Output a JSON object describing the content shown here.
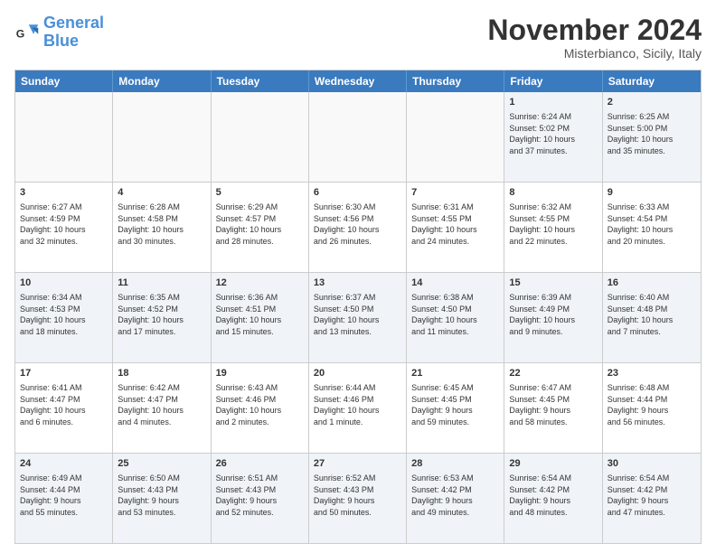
{
  "logo": {
    "line1": "General",
    "line2": "Blue"
  },
  "title": "November 2024",
  "subtitle": "Misterbianco, Sicily, Italy",
  "header_days": [
    "Sunday",
    "Monday",
    "Tuesday",
    "Wednesday",
    "Thursday",
    "Friday",
    "Saturday"
  ],
  "weeks": [
    [
      {
        "day": "",
        "info": ""
      },
      {
        "day": "",
        "info": ""
      },
      {
        "day": "",
        "info": ""
      },
      {
        "day": "",
        "info": ""
      },
      {
        "day": "",
        "info": ""
      },
      {
        "day": "1",
        "info": "Sunrise: 6:24 AM\nSunset: 5:02 PM\nDaylight: 10 hours\nand 37 minutes."
      },
      {
        "day": "2",
        "info": "Sunrise: 6:25 AM\nSunset: 5:00 PM\nDaylight: 10 hours\nand 35 minutes."
      }
    ],
    [
      {
        "day": "3",
        "info": "Sunrise: 6:27 AM\nSunset: 4:59 PM\nDaylight: 10 hours\nand 32 minutes."
      },
      {
        "day": "4",
        "info": "Sunrise: 6:28 AM\nSunset: 4:58 PM\nDaylight: 10 hours\nand 30 minutes."
      },
      {
        "day": "5",
        "info": "Sunrise: 6:29 AM\nSunset: 4:57 PM\nDaylight: 10 hours\nand 28 minutes."
      },
      {
        "day": "6",
        "info": "Sunrise: 6:30 AM\nSunset: 4:56 PM\nDaylight: 10 hours\nand 26 minutes."
      },
      {
        "day": "7",
        "info": "Sunrise: 6:31 AM\nSunset: 4:55 PM\nDaylight: 10 hours\nand 24 minutes."
      },
      {
        "day": "8",
        "info": "Sunrise: 6:32 AM\nSunset: 4:55 PM\nDaylight: 10 hours\nand 22 minutes."
      },
      {
        "day": "9",
        "info": "Sunrise: 6:33 AM\nSunset: 4:54 PM\nDaylight: 10 hours\nand 20 minutes."
      }
    ],
    [
      {
        "day": "10",
        "info": "Sunrise: 6:34 AM\nSunset: 4:53 PM\nDaylight: 10 hours\nand 18 minutes."
      },
      {
        "day": "11",
        "info": "Sunrise: 6:35 AM\nSunset: 4:52 PM\nDaylight: 10 hours\nand 17 minutes."
      },
      {
        "day": "12",
        "info": "Sunrise: 6:36 AM\nSunset: 4:51 PM\nDaylight: 10 hours\nand 15 minutes."
      },
      {
        "day": "13",
        "info": "Sunrise: 6:37 AM\nSunset: 4:50 PM\nDaylight: 10 hours\nand 13 minutes."
      },
      {
        "day": "14",
        "info": "Sunrise: 6:38 AM\nSunset: 4:50 PM\nDaylight: 10 hours\nand 11 minutes."
      },
      {
        "day": "15",
        "info": "Sunrise: 6:39 AM\nSunset: 4:49 PM\nDaylight: 10 hours\nand 9 minutes."
      },
      {
        "day": "16",
        "info": "Sunrise: 6:40 AM\nSunset: 4:48 PM\nDaylight: 10 hours\nand 7 minutes."
      }
    ],
    [
      {
        "day": "17",
        "info": "Sunrise: 6:41 AM\nSunset: 4:47 PM\nDaylight: 10 hours\nand 6 minutes."
      },
      {
        "day": "18",
        "info": "Sunrise: 6:42 AM\nSunset: 4:47 PM\nDaylight: 10 hours\nand 4 minutes."
      },
      {
        "day": "19",
        "info": "Sunrise: 6:43 AM\nSunset: 4:46 PM\nDaylight: 10 hours\nand 2 minutes."
      },
      {
        "day": "20",
        "info": "Sunrise: 6:44 AM\nSunset: 4:46 PM\nDaylight: 10 hours\nand 1 minute."
      },
      {
        "day": "21",
        "info": "Sunrise: 6:45 AM\nSunset: 4:45 PM\nDaylight: 9 hours\nand 59 minutes."
      },
      {
        "day": "22",
        "info": "Sunrise: 6:47 AM\nSunset: 4:45 PM\nDaylight: 9 hours\nand 58 minutes."
      },
      {
        "day": "23",
        "info": "Sunrise: 6:48 AM\nSunset: 4:44 PM\nDaylight: 9 hours\nand 56 minutes."
      }
    ],
    [
      {
        "day": "24",
        "info": "Sunrise: 6:49 AM\nSunset: 4:44 PM\nDaylight: 9 hours\nand 55 minutes."
      },
      {
        "day": "25",
        "info": "Sunrise: 6:50 AM\nSunset: 4:43 PM\nDaylight: 9 hours\nand 53 minutes."
      },
      {
        "day": "26",
        "info": "Sunrise: 6:51 AM\nSunset: 4:43 PM\nDaylight: 9 hours\nand 52 minutes."
      },
      {
        "day": "27",
        "info": "Sunrise: 6:52 AM\nSunset: 4:43 PM\nDaylight: 9 hours\nand 50 minutes."
      },
      {
        "day": "28",
        "info": "Sunrise: 6:53 AM\nSunset: 4:42 PM\nDaylight: 9 hours\nand 49 minutes."
      },
      {
        "day": "29",
        "info": "Sunrise: 6:54 AM\nSunset: 4:42 PM\nDaylight: 9 hours\nand 48 minutes."
      },
      {
        "day": "30",
        "info": "Sunrise: 6:54 AM\nSunset: 4:42 PM\nDaylight: 9 hours\nand 47 minutes."
      }
    ]
  ]
}
